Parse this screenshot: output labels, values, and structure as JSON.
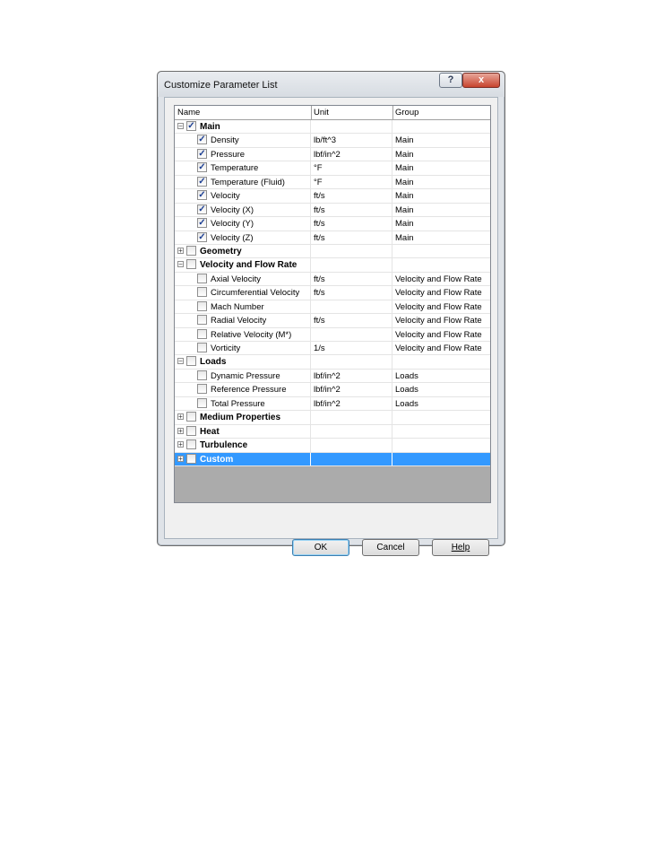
{
  "dialog": {
    "title": "Customize Parameter List",
    "help_glyph": "?",
    "close_glyph": "x"
  },
  "table": {
    "headers": [
      "Name",
      "Unit",
      "Group"
    ],
    "rows": [
      {
        "level": 0,
        "expander": "−",
        "checked": true,
        "name": "Main",
        "unit": "",
        "group": ""
      },
      {
        "level": 1,
        "checked": true,
        "name": "Density",
        "unit": "lb/ft^3",
        "group": "Main"
      },
      {
        "level": 1,
        "checked": true,
        "name": "Pressure",
        "unit": "lbf/in^2",
        "group": "Main"
      },
      {
        "level": 1,
        "checked": true,
        "name": "Temperature",
        "unit": "°F",
        "group": "Main"
      },
      {
        "level": 1,
        "checked": true,
        "name": "Temperature (Fluid)",
        "unit": "°F",
        "group": "Main"
      },
      {
        "level": 1,
        "checked": true,
        "name": "Velocity",
        "unit": "ft/s",
        "group": "Main"
      },
      {
        "level": 1,
        "checked": true,
        "name": "Velocity (X)",
        "unit": "ft/s",
        "group": "Main"
      },
      {
        "level": 1,
        "checked": true,
        "name": "Velocity (Y)",
        "unit": "ft/s",
        "group": "Main"
      },
      {
        "level": 1,
        "checked": true,
        "name": "Velocity (Z)",
        "unit": "ft/s",
        "group": "Main"
      },
      {
        "level": 0,
        "expander": "+",
        "checked": false,
        "name": "Geometry",
        "unit": "",
        "group": ""
      },
      {
        "level": 0,
        "expander": "−",
        "checked": false,
        "name": "Velocity and Flow Rate",
        "unit": "",
        "group": ""
      },
      {
        "level": 1,
        "checked": false,
        "name": "Axial Velocity",
        "unit": "ft/s",
        "group": "Velocity and Flow Rate"
      },
      {
        "level": 1,
        "checked": false,
        "name": "Circumferential Velocity",
        "unit": "ft/s",
        "group": "Velocity and Flow Rate"
      },
      {
        "level": 1,
        "checked": false,
        "name": "Mach Number",
        "unit": "",
        "group": "Velocity and Flow Rate"
      },
      {
        "level": 1,
        "checked": false,
        "name": "Radial Velocity",
        "unit": "ft/s",
        "group": "Velocity and Flow Rate"
      },
      {
        "level": 1,
        "checked": false,
        "name": "Relative Velocity (M*)",
        "unit": "",
        "group": "Velocity and Flow Rate"
      },
      {
        "level": 1,
        "checked": false,
        "name": "Vorticity",
        "unit": "1/s",
        "group": "Velocity and Flow Rate"
      },
      {
        "level": 0,
        "expander": "−",
        "checked": false,
        "name": "Loads",
        "unit": "",
        "group": ""
      },
      {
        "level": 1,
        "checked": false,
        "name": "Dynamic Pressure",
        "unit": "lbf/in^2",
        "group": "Loads"
      },
      {
        "level": 1,
        "checked": false,
        "name": "Reference Pressure",
        "unit": "lbf/in^2",
        "group": "Loads"
      },
      {
        "level": 1,
        "checked": false,
        "name": "Total Pressure",
        "unit": "lbf/in^2",
        "group": "Loads"
      },
      {
        "level": 0,
        "expander": "+",
        "checked": false,
        "name": "Medium Properties",
        "unit": "",
        "group": ""
      },
      {
        "level": 0,
        "expander": "+",
        "checked": false,
        "name": "Heat",
        "unit": "",
        "group": ""
      },
      {
        "level": 0,
        "expander": "+",
        "checked": false,
        "name": "Turbulence",
        "unit": "",
        "group": ""
      },
      {
        "level": 0,
        "expander": "+",
        "checked": false,
        "name": "Custom",
        "unit": "",
        "group": "",
        "selected": true
      }
    ]
  },
  "buttons": {
    "ok": "OK",
    "cancel": "Cancel",
    "help": "Help"
  },
  "colors": {
    "selection": "#3399ff",
    "empty_area": "#ababab"
  }
}
